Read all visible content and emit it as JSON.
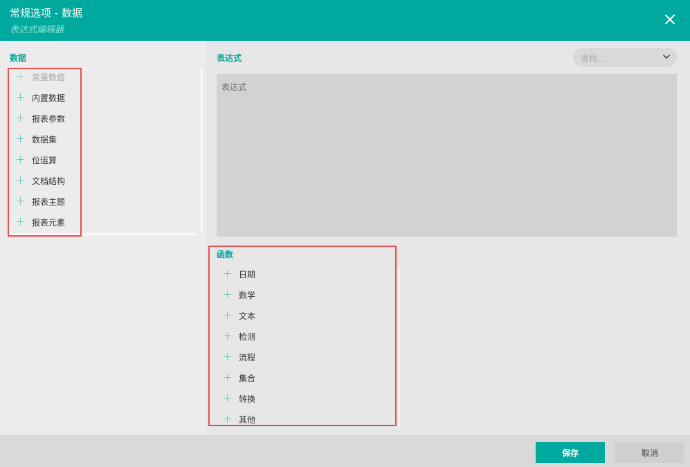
{
  "dialog": {
    "title": "常规选项 - 数据",
    "subtitle": "表达式编辑器",
    "close_icon": "close-icon"
  },
  "data_panel": {
    "label": "数据",
    "items": [
      {
        "label": "常量数值",
        "icon": "plus-icon"
      },
      {
        "label": "内置数据",
        "icon": "plus-icon"
      },
      {
        "label": "报表参数",
        "icon": "plus-icon"
      },
      {
        "label": "数据集",
        "icon": "plus-icon"
      },
      {
        "label": "位运算",
        "icon": "plus-icon"
      },
      {
        "label": "文档结构",
        "icon": "plus-icon"
      },
      {
        "label": "报表主题",
        "icon": "plus-icon"
      },
      {
        "label": "报表元素",
        "icon": "plus-icon"
      }
    ]
  },
  "expression": {
    "label": "表达式",
    "placeholder": "表达式",
    "search_placeholder": "查找..."
  },
  "functions": {
    "label": "函数",
    "items": [
      {
        "label": "日期",
        "icon": "plus-icon"
      },
      {
        "label": "数学",
        "icon": "plus-icon"
      },
      {
        "label": "文本",
        "icon": "plus-icon"
      },
      {
        "label": "检测",
        "icon": "plus-icon"
      },
      {
        "label": "流程",
        "icon": "plus-icon"
      },
      {
        "label": "集合",
        "icon": "plus-icon"
      },
      {
        "label": "转换",
        "icon": "plus-icon"
      },
      {
        "label": "其他",
        "icon": "plus-icon"
      }
    ]
  },
  "footer": {
    "save_label": "保存",
    "cancel_label": "取消"
  },
  "colors": {
    "accent": "#00a99d",
    "highlight": "#e84c4c"
  }
}
